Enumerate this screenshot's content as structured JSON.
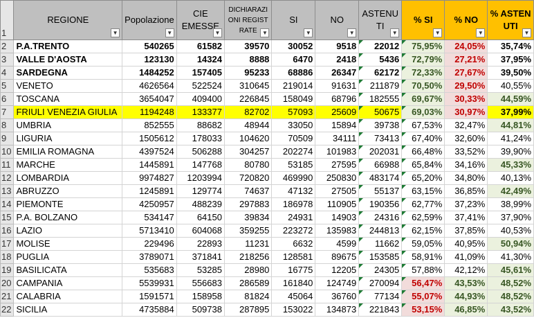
{
  "headers": {
    "regione": "REGIONE",
    "popolazione": "Popolazione",
    "cie": "CIE EMESSE",
    "dichiarazioni": "DICHIARAZIONI REGISTRATE",
    "si": "SI",
    "no": "NO",
    "astenuti": "ASTENUTI",
    "pct_si": "% SI",
    "pct_no": "% NO",
    "pct_astenuti": "% ASTENUTI"
  },
  "filter_icon": "dropdown-arrow-icon",
  "rows": [
    {
      "n": "1"
    },
    {
      "n": "2",
      "regione": "P.A.TRENTO",
      "pop": "540265",
      "cie": "61582",
      "dich": "39570",
      "si": "30052",
      "no": "9518",
      "ast": "22012",
      "psi": "75,95%",
      "pno": "24,05%",
      "past": "35,74%"
    },
    {
      "n": "3",
      "regione": "VALLE D'AOSTA",
      "pop": "123130",
      "cie": "14324",
      "dich": "8888",
      "si": "6470",
      "no": "2418",
      "ast": "5436",
      "psi": "72,79%",
      "pno": "27,21%",
      "past": "37,95%"
    },
    {
      "n": "4",
      "regione": "SARDEGNA",
      "pop": "1484252",
      "cie": "157405",
      "dich": "95233",
      "si": "68886",
      "no": "26347",
      "ast": "62172",
      "psi": "72,33%",
      "pno": "27,67%",
      "past": "39,50%"
    },
    {
      "n": "5",
      "regione": "VENETO",
      "pop": "4626564",
      "cie": "522524",
      "dich": "310645",
      "si": "219014",
      "no": "91631",
      "ast": "211879",
      "psi": "70,50%",
      "pno": "29,50%",
      "past": "40,55%"
    },
    {
      "n": "6",
      "regione": "TOSCANA",
      "pop": "3654047",
      "cie": "409400",
      "dich": "226845",
      "si": "158049",
      "no": "68796",
      "ast": "182555",
      "psi": "69,67%",
      "pno": "30,33%",
      "past": "44,59%"
    },
    {
      "n": "7",
      "regione": "FRIULI VENEZIA GIULIA",
      "pop": "1194248",
      "cie": "133377",
      "dich": "82702",
      "si": "57093",
      "no": "25609",
      "ast": "50675",
      "psi": "69,03%",
      "pno": "30,97%",
      "past": "37,99%"
    },
    {
      "n": "8",
      "regione": "UMBRIA",
      "pop": "852555",
      "cie": "88682",
      "dich": "48944",
      "si": "33050",
      "no": "15894",
      "ast": "39738",
      "psi": "67,53%",
      "pno": "32,47%",
      "past": "44,81%"
    },
    {
      "n": "9",
      "regione": "LIGURIA",
      "pop": "1505612",
      "cie": "178033",
      "dich": "104620",
      "si": "70509",
      "no": "34111",
      "ast": "73413",
      "psi": "67,40%",
      "pno": "32,60%",
      "past": "41,24%"
    },
    {
      "n": "10",
      "regione": "EMILIA ROMAGNA",
      "pop": "4397524",
      "cie": "506288",
      "dich": "304257",
      "si": "202274",
      "no": "101983",
      "ast": "202031",
      "psi": "66,48%",
      "pno": "33,52%",
      "past": "39,90%"
    },
    {
      "n": "11",
      "regione": "MARCHE",
      "pop": "1445891",
      "cie": "147768",
      "dich": "80780",
      "si": "53185",
      "no": "27595",
      "ast": "66988",
      "psi": "65,84%",
      "pno": "34,16%",
      "past": "45,33%"
    },
    {
      "n": "12",
      "regione": "LOMBARDIA",
      "pop": "9974827",
      "cie": "1203994",
      "dich": "720820",
      "si": "469990",
      "no": "250830",
      "ast": "483174",
      "psi": "65,20%",
      "pno": "34,80%",
      "past": "40,13%"
    },
    {
      "n": "13",
      "regione": "ABRUZZO",
      "pop": "1245891",
      "cie": "129774",
      "dich": "74637",
      "si": "47132",
      "no": "27505",
      "ast": "55137",
      "psi": "63,15%",
      "pno": "36,85%",
      "past": "42,49%"
    },
    {
      "n": "14",
      "regione": "PIEMONTE",
      "pop": "4250957",
      "cie": "488239",
      "dich": "297883",
      "si": "186978",
      "no": "110905",
      "ast": "190356",
      "psi": "62,77%",
      "pno": "37,23%",
      "past": "38,99%"
    },
    {
      "n": "15",
      "regione": "P.A. BOLZANO",
      "pop": "534147",
      "cie": "64150",
      "dich": "39834",
      "si": "24931",
      "no": "14903",
      "ast": "24316",
      "psi": "62,59%",
      "pno": "37,41%",
      "past": "37,90%"
    },
    {
      "n": "16",
      "regione": "LAZIO",
      "pop": "5713410",
      "cie": "604068",
      "dich": "359255",
      "si": "223272",
      "no": "135983",
      "ast": "244813",
      "psi": "62,15%",
      "pno": "37,85%",
      "past": "40,53%"
    },
    {
      "n": "17",
      "regione": "MOLISE",
      "pop": "229496",
      "cie": "22893",
      "dich": "11231",
      "si": "6632",
      "no": "4599",
      "ast": "11662",
      "psi": "59,05%",
      "pno": "40,95%",
      "past": "50,94%"
    },
    {
      "n": "18",
      "regione": "PUGLIA",
      "pop": "3789071",
      "cie": "371841",
      "dich": "218256",
      "si": "128581",
      "no": "89675",
      "ast": "153585",
      "psi": "58,91%",
      "pno": "41,09%",
      "past": "41,30%"
    },
    {
      "n": "19",
      "regione": "BASILICATA",
      "pop": "535683",
      "cie": "53285",
      "dich": "28980",
      "si": "16775",
      "no": "12205",
      "ast": "24305",
      "psi": "57,88%",
      "pno": "42,12%",
      "past": "45,61%"
    },
    {
      "n": "20",
      "regione": "CAMPANIA",
      "pop": "5539931",
      "cie": "556683",
      "dich": "286589",
      "si": "161840",
      "no": "124749",
      "ast": "270094",
      "psi": "56,47%",
      "pno": "43,53%",
      "past": "48,52%"
    },
    {
      "n": "21",
      "regione": "CALABRIA",
      "pop": "1591571",
      "cie": "158958",
      "dich": "81824",
      "si": "45064",
      "no": "36760",
      "ast": "77134",
      "psi": "55,07%",
      "pno": "44,93%",
      "past": "48,52%"
    },
    {
      "n": "22",
      "regione": "SICILIA",
      "pop": "4735884",
      "cie": "509738",
      "dich": "287895",
      "si": "153022",
      "no": "134873",
      "ast": "221843",
      "psi": "53,15%",
      "pno": "46,85%",
      "past": "43,52%"
    }
  ]
}
